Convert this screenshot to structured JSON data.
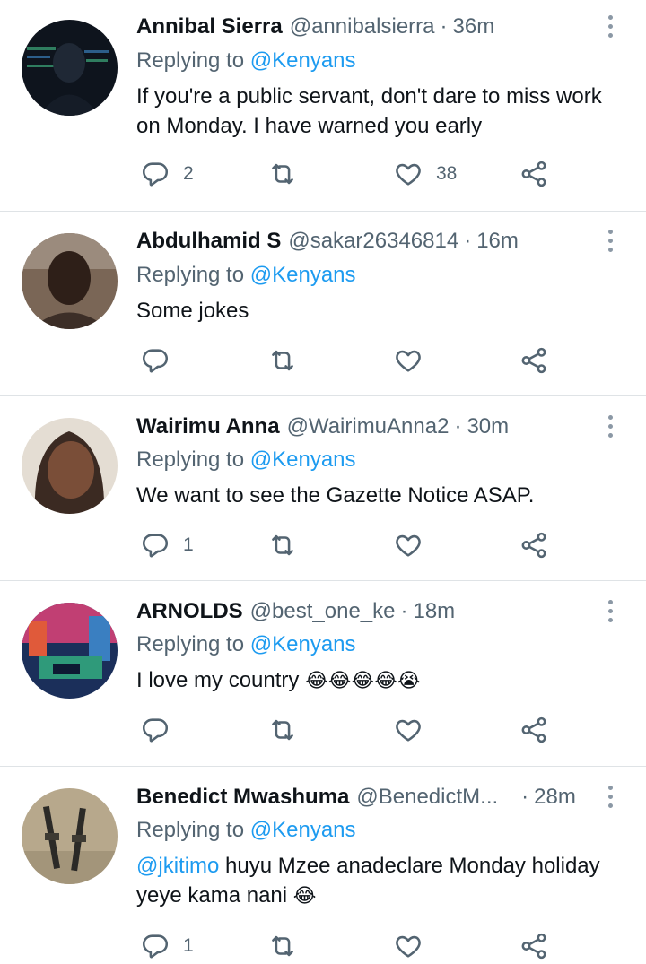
{
  "tweets": [
    {
      "name": "Annibal Sierra",
      "handle": "@annibalsierra",
      "time": "36m",
      "replying_prefix": "Replying to",
      "replying_to": "@Kenyans",
      "text": "If you're a public servant, don't dare to miss work on Monday. I have warned you early",
      "replies": "2",
      "retweets": "",
      "likes": "38",
      "avatar_colors": [
        "#1a2333",
        "#0b0f16"
      ]
    },
    {
      "name": "Abdulhamid S",
      "handle": "@sakar26346814",
      "time": "16m",
      "replying_prefix": "Replying to",
      "replying_to": "@Kenyans",
      "text": "Some jokes",
      "replies": "",
      "retweets": "",
      "likes": "",
      "avatar_colors": [
        "#6b4a36",
        "#2a1c14"
      ]
    },
    {
      "name": "Wairimu Anna",
      "handle": "@WairimuAnna2",
      "time": "30m",
      "replying_prefix": "Replying to",
      "replying_to": "@Kenyans",
      "text": "We want to see the Gazette Notice ASAP.",
      "replies": "1",
      "retweets": "",
      "likes": "",
      "avatar_colors": [
        "#d9c6b4",
        "#5b3a2a"
      ]
    },
    {
      "name": "ARNOLDS",
      "handle": "@best_one_ke",
      "time": "18m",
      "replying_prefix": "Replying to",
      "replying_to": "@Kenyans",
      "text": "I love my country",
      "emoji": "😂😂😂😂😭",
      "replies": "",
      "retweets": "",
      "likes": "",
      "avatar_colors": [
        "#c0396b",
        "#1b3f7a"
      ]
    },
    {
      "name": "Benedict Mwashuma",
      "handle": "@BenedictM...",
      "time": "28m",
      "replying_prefix": "Replying to",
      "replying_to": "@Kenyans",
      "text_mention": "@jkitimo",
      "text": "huyu Mzee anadeclare Monday holiday yeye kama nani",
      "emoji": "😂",
      "replies": "1",
      "retweets": "",
      "likes": "",
      "avatar_colors": [
        "#b3a58a",
        "#3d3a33"
      ]
    }
  ],
  "icons": {
    "more": "more-vertical-icon",
    "reply": "reply-bubble-icon",
    "retweet": "retweet-icon",
    "like": "heart-icon",
    "share": "share-icon"
  },
  "colors": {
    "text": "#0f1419",
    "secondary": "#536471",
    "accent": "#1d9bf0",
    "divider": "#dfe3e6"
  }
}
